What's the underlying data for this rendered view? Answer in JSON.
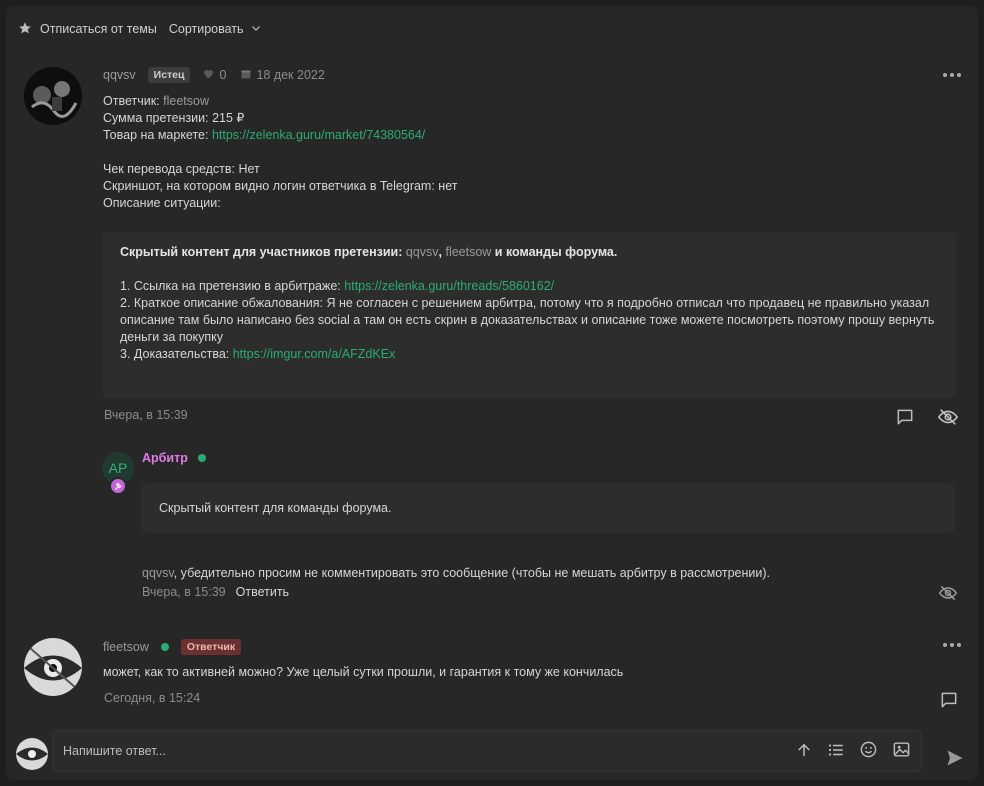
{
  "topbar": {
    "unsubscribe": "Отписаться от темы",
    "sort": "Сортировать"
  },
  "post1": {
    "author": "qqvsv",
    "role_badge": "Истец",
    "likes": "0",
    "date": "18 дек 2022",
    "lines": {
      "respondent_label": "Ответчик: ",
      "respondent": "fleetsow",
      "amount": "Сумма претензии: 215 ₽",
      "market_label": "Товар на маркете: ",
      "market_link": "https://zelenka.guru/market/74380564/",
      "receipt": "Чек перевода средств: Нет",
      "screenshot": "Скриншот, на котором видно логин ответчика в Telegram: нет",
      "description": "Описание ситуации:"
    },
    "hidden": {
      "title_pre": "Скрытый контент для участников претензии: ",
      "nick1": "qqvsv",
      "comma": ", ",
      "nick2": "fleetsow",
      "title_post": " и команды форума.",
      "item1_label": "1. Ссылка на претензию в арбитраже: ",
      "item1_link": "https://zelenka.guru/threads/5860162/",
      "item2": "2. Краткое описание обжалования: Я не согласен с решением арбитра, потому что я подробно отписал что продавец не правильно указал описание там было написано без social а там он есть скрин в доказательствах и описание тоже можете посмотреть поэтому прошу вернуть деньги за покупку",
      "item3_label": "3. Доказательства: ",
      "item3_link": "https://imgur.com/a/AFZdKEx"
    },
    "time": "Вчера, в 15:39"
  },
  "comment": {
    "avatar_initials": "AP",
    "author": "Арбитр",
    "hidden_text": "Скрытый контент для команды форума.",
    "note_nick": "qqvsv",
    "note_text": ", убедительно просим не комментировать это сообщение (чтобы не мешать арбитру в рассмотрении).",
    "time": "Вчера, в 15:39",
    "reply": "Ответить"
  },
  "post2": {
    "author": "fleetsow",
    "role_badge": "Ответчик",
    "text": "может, как то активней можно? Уже целый сутки прошли, и гарантия к тому же кончилась",
    "time": "Сегодня, в 15:24"
  },
  "reply": {
    "placeholder": "Напишите ответ..."
  },
  "colors": {
    "accent": "#2bad72",
    "arbiter": "#e07ce8",
    "badge_defendant": "#6b3131"
  }
}
